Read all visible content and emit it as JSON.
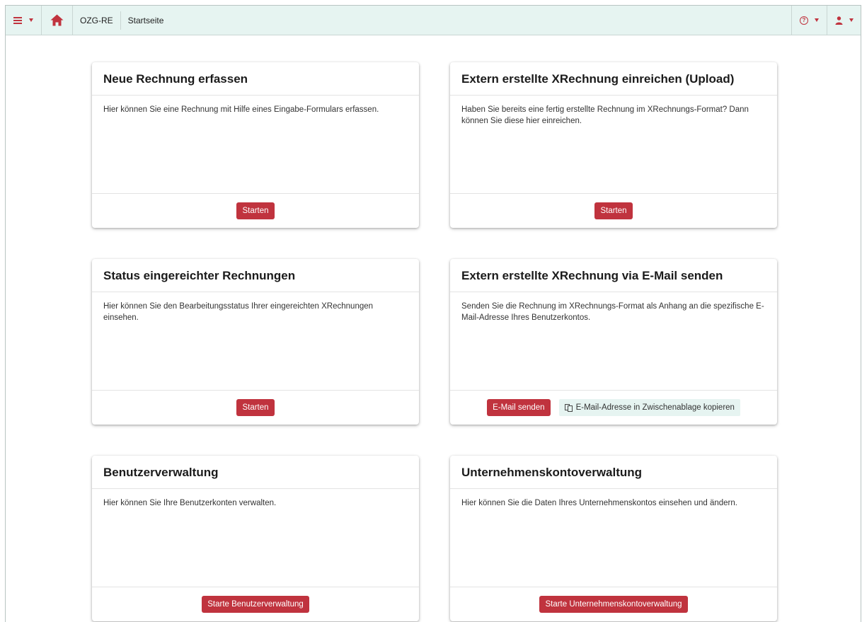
{
  "topbar": {
    "app_name": "OZG-RE",
    "page_name": "Startseite",
    "accent_color": "#c0333e",
    "background_color": "#e6f4f1"
  },
  "cards": [
    {
      "title": "Neue Rechnung erfassen",
      "text": "Hier können Sie eine Rechnung mit Hilfe eines Eingabe-Formulars erfassen.",
      "button_label": "Starten"
    },
    {
      "title": "Extern erstellte XRechnung einreichen (Upload)",
      "text": "Haben Sie bereits eine fertig erstellte Rechnung im XRechnungs-Format? Dann können Sie diese hier einreichen.",
      "button_label": "Starten"
    },
    {
      "title": "Status eingereichter Rechnungen",
      "text": "Hier können Sie den Bearbeitungsstatus Ihrer eingereichten XRechnungen einsehen.",
      "button_label": "Starten"
    },
    {
      "title": "Extern erstellte XRechnung via E-Mail senden",
      "text": "Senden Sie die Rechnung im XRechnungs-Format als Anhang an die spezifische E-Mail-Adresse Ihres Benutzerkontos.",
      "button_label": "E-Mail senden",
      "secondary_button_label": "E-Mail-Adresse in Zwischenablage kopieren"
    },
    {
      "title": "Benutzerverwaltung",
      "text": "Hier können Sie Ihre Benutzerkonten verwalten.",
      "button_label": "Starte Benutzerverwaltung"
    },
    {
      "title": "Unternehmenskontoverwaltung",
      "text": "Hier können Sie die Daten Ihres Unternehmenskontos einsehen und ändern.",
      "button_label": "Starte Unternehmenskontoverwaltung"
    }
  ],
  "icons": {
    "menu": "hamburger-menu-icon",
    "home": "home-icon",
    "help": "help-circle-icon",
    "user": "user-icon",
    "copy": "clipboard-copy-icon",
    "dropdown": "caret-down-icon"
  }
}
